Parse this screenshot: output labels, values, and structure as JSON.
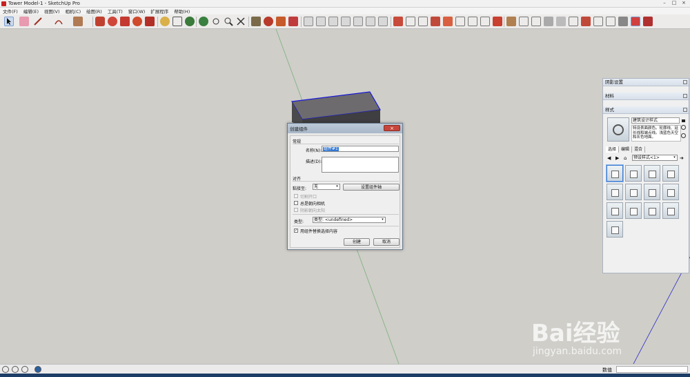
{
  "window": {
    "title": "Tower Model-1 - SketchUp Pro",
    "controls": [
      "–",
      "□",
      "×"
    ]
  },
  "menu": [
    "文件(F)",
    "编辑(E)",
    "视图(V)",
    "相机(C)",
    "绘图(R)",
    "工具(T)",
    "窗口(W)",
    "扩展程序",
    "帮助(H)"
  ],
  "dialog": {
    "title": "创建组件",
    "close_label": "×",
    "general_label": "常规",
    "name_label": "名称(N):",
    "name_value": "组件#1",
    "desc_label": "描述(D):",
    "align_label": "对齐",
    "glue_label": "黏接至:",
    "glue_value": "无",
    "set_axis_label": "设置组件轴",
    "cut_opening_label": "切割开口",
    "face_camera_label": "总是朝向相机",
    "shadows_face_sun_label": "阴影朝向太阳",
    "type_label": "类型:",
    "type_value": "类型: <undefined>",
    "replace_label": "用组件替换选择内容",
    "replace_checked": true,
    "create_label": "创建",
    "cancel_label": "取消"
  },
  "tray": {
    "shadow_panel": "阴影设置",
    "materials_panel": "材料",
    "styles_panel": "样式",
    "style_name": "建筑设计样式",
    "style_desc": "特设表面颜色。轮廓线、延长线和端点线。浅蓝色天空和灰色地面。",
    "tabs": [
      "选择",
      "编辑",
      "混合"
    ],
    "collection": "预设样式<1>",
    "thumb_count": 13
  },
  "status": {
    "measure_label": "数值",
    "measure_value": ""
  },
  "watermark": {
    "text": "Bai经验",
    "url": "jingyan.baidu.com"
  }
}
